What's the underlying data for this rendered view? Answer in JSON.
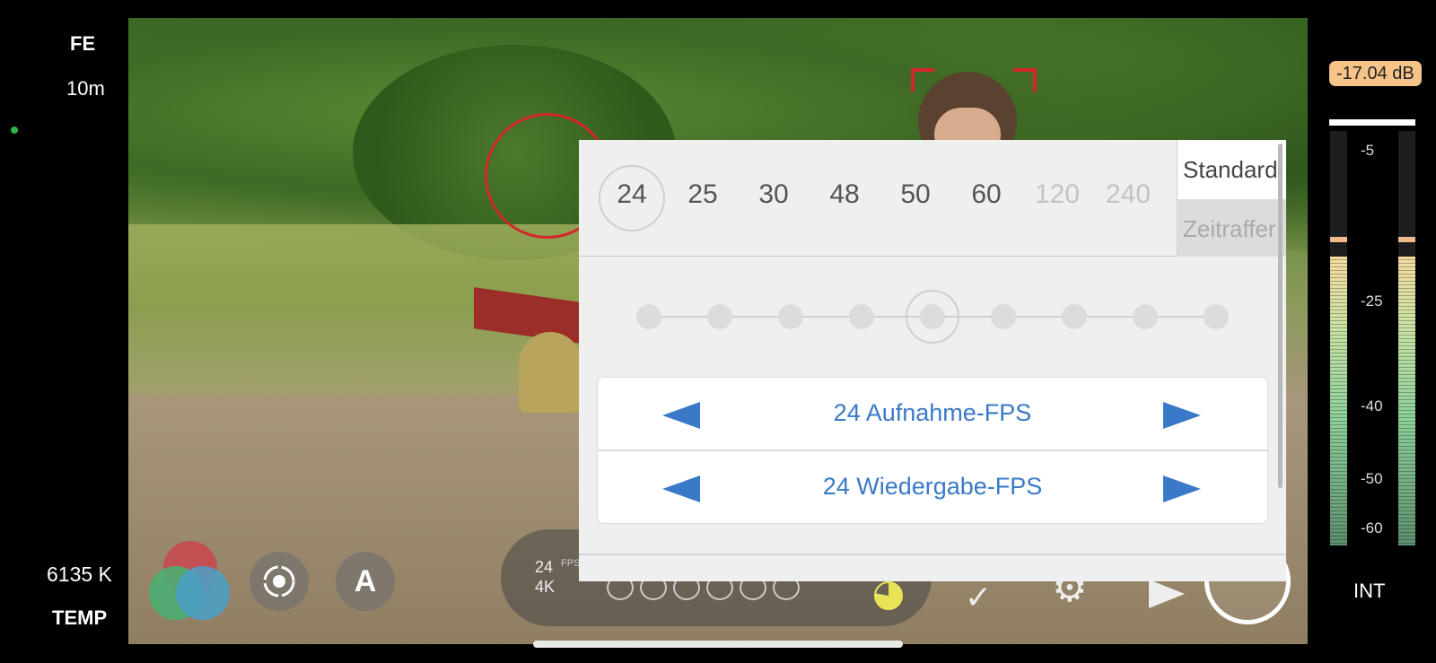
{
  "left_panel": {
    "lens_mode": "FE",
    "focus_distance": "10m",
    "white_balance_value": "6135 K",
    "white_balance_label": "TEMP"
  },
  "bottom_bar": {
    "auto_label": "A",
    "status": {
      "fps": "24",
      "fps_unit": "FPS",
      "resolution": "4K"
    },
    "battery_or_storage_level": 0.78
  },
  "fps_popup": {
    "frame_rates": [
      {
        "label": "24",
        "selected": true,
        "enabled": true
      },
      {
        "label": "25",
        "selected": false,
        "enabled": true
      },
      {
        "label": "30",
        "selected": false,
        "enabled": true
      },
      {
        "label": "48",
        "selected": false,
        "enabled": true
      },
      {
        "label": "50",
        "selected": false,
        "enabled": true
      },
      {
        "label": "60",
        "selected": false,
        "enabled": true
      },
      {
        "label": "120",
        "selected": false,
        "enabled": false
      },
      {
        "label": "240",
        "selected": false,
        "enabled": false
      }
    ],
    "modes": {
      "standard": "Standard",
      "timelapse": "Zeitraffer"
    },
    "slider": {
      "stops": 9,
      "selected_index": 4
    },
    "capture_fps_label": "24 Aufnahme-FPS",
    "playback_fps_label": "24 Wiedergabe-FPS"
  },
  "audio_meter": {
    "level": "-17.04 dB",
    "ticks": [
      "-5",
      "-25",
      "-40",
      "-50",
      "-60"
    ],
    "input_source": "INT"
  },
  "colors": {
    "accent_blue": "#3a79c7",
    "focus_red": "#d2272b",
    "db_badge": "#f6c388"
  }
}
